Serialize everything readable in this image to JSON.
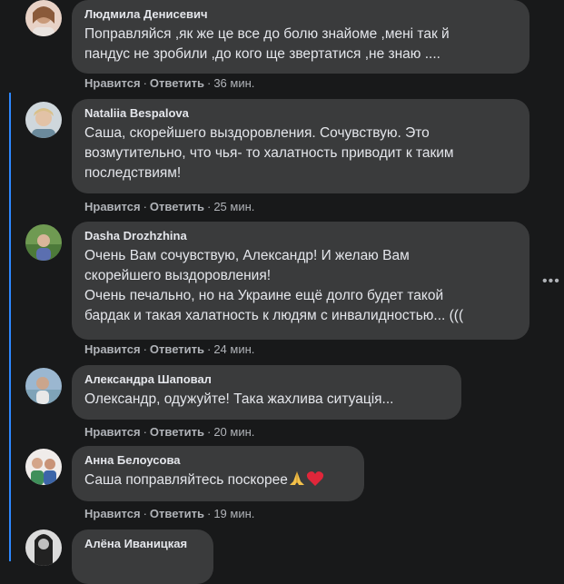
{
  "actions": {
    "like": "Нравится",
    "reply": "Ответить"
  },
  "more_label": "•••",
  "comments": [
    {
      "name": "Людмила Денисевич",
      "text": "Поправляйся ,як же це все до болю знайоме ,мені так й\nпандус не зробили ,до кого ще звертатися ,не знаю ....",
      "time": "36 мин."
    },
    {
      "name": "Nataliia Bespalova",
      "text": "Саша, скорейшего выздоровления. Сочувствую. Это\nвозмутительно, что чья- то халатность приводит к таким\nпоследствиям!",
      "time": "25 мин."
    },
    {
      "name": "Dasha Drozhzhina",
      "text": "Очень Вам сочувствую, Александр! И желаю Вам\nскорейшего выздоровления!\nОчень печально, но на Украине ещё долго будет такой\nбардак и такая халатность к людям с инвалидностью... (((",
      "time": "24 мин."
    },
    {
      "name": "Александра Шаповал",
      "text": "Олександр, одужуйте! Така жахлива ситуація...",
      "time": "20 мин."
    },
    {
      "name": "Анна Белоусова",
      "text": "Саша поправляйтесь поскорее",
      "time": "19 мин."
    },
    {
      "name": "Алёна Иваницкая",
      "text": "",
      "time": ""
    }
  ]
}
